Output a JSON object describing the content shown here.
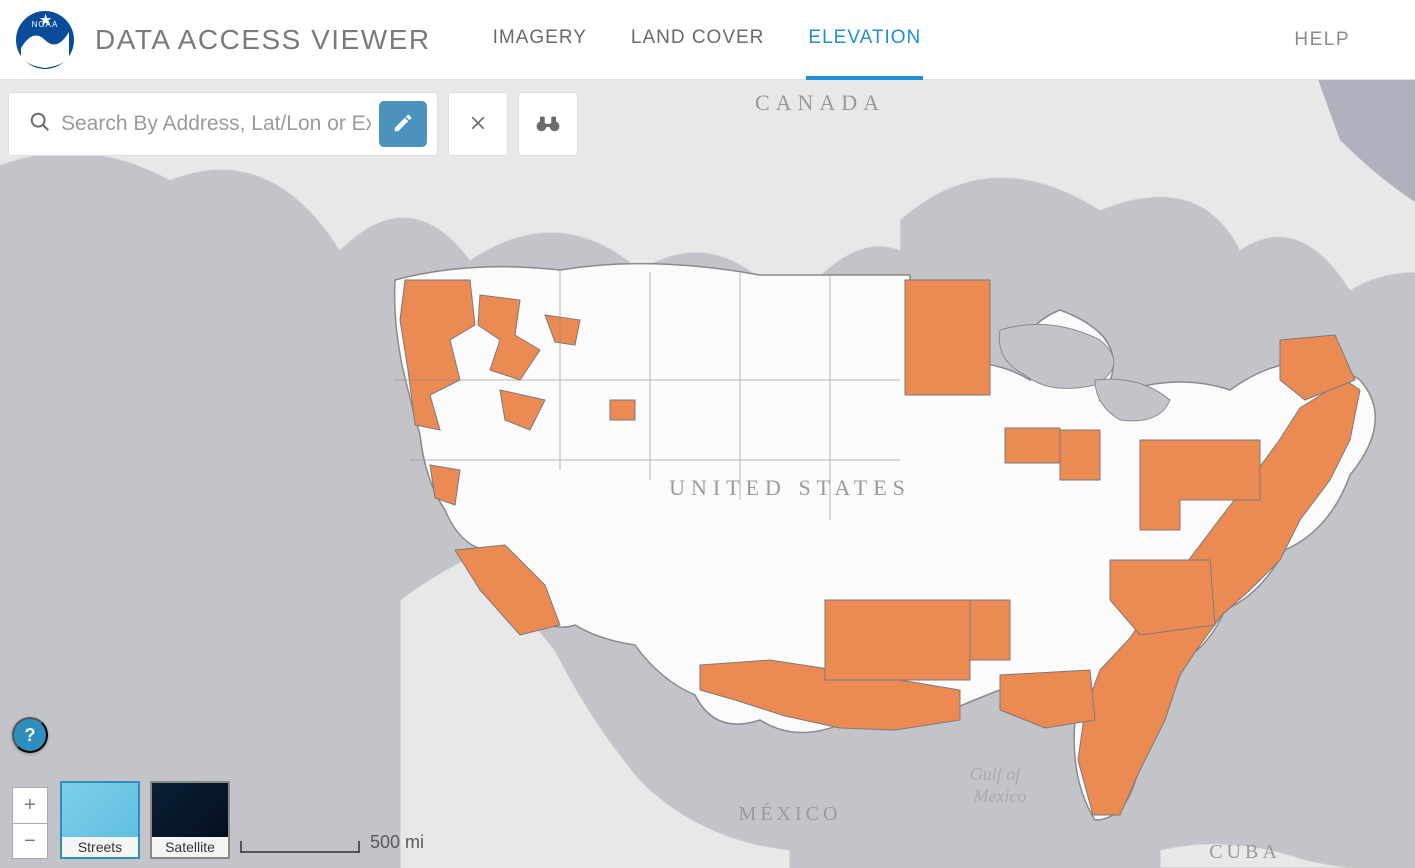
{
  "header": {
    "title": "DATA ACCESS VIEWER",
    "tabs": [
      {
        "label": "IMAGERY",
        "active": false
      },
      {
        "label": "LAND COVER",
        "active": false
      },
      {
        "label": "ELEVATION",
        "active": true
      }
    ],
    "help_label": "HELP"
  },
  "search": {
    "placeholder": "Search By Address, Lat/Lon or Extent",
    "value": ""
  },
  "toolbar": {
    "draw_tool": "pencil-icon",
    "clear_tool": "close-icon",
    "extent_tool": "binoculars-icon"
  },
  "map": {
    "labels": {
      "canada": "CANADA",
      "united_states": "UNITED STATES",
      "mexico": "MÉXICO",
      "cuba": "CUBA",
      "gulf_of": "Gulf of",
      "gulf_mexico": "Mexico"
    },
    "scale_label": "500 mi",
    "help_button": "?",
    "zoom_in": "+",
    "zoom_out": "−"
  },
  "basemaps": [
    {
      "key": "streets",
      "label": "Streets",
      "selected": true
    },
    {
      "key": "satellite",
      "label": "Satellite",
      "selected": false
    }
  ],
  "colors": {
    "accent": "#1e8fd6",
    "data_overlay": "#ec8a54",
    "water": "#c3c3ca",
    "land_us": "#fbfbfb",
    "land_other": "#e8e8e8"
  }
}
